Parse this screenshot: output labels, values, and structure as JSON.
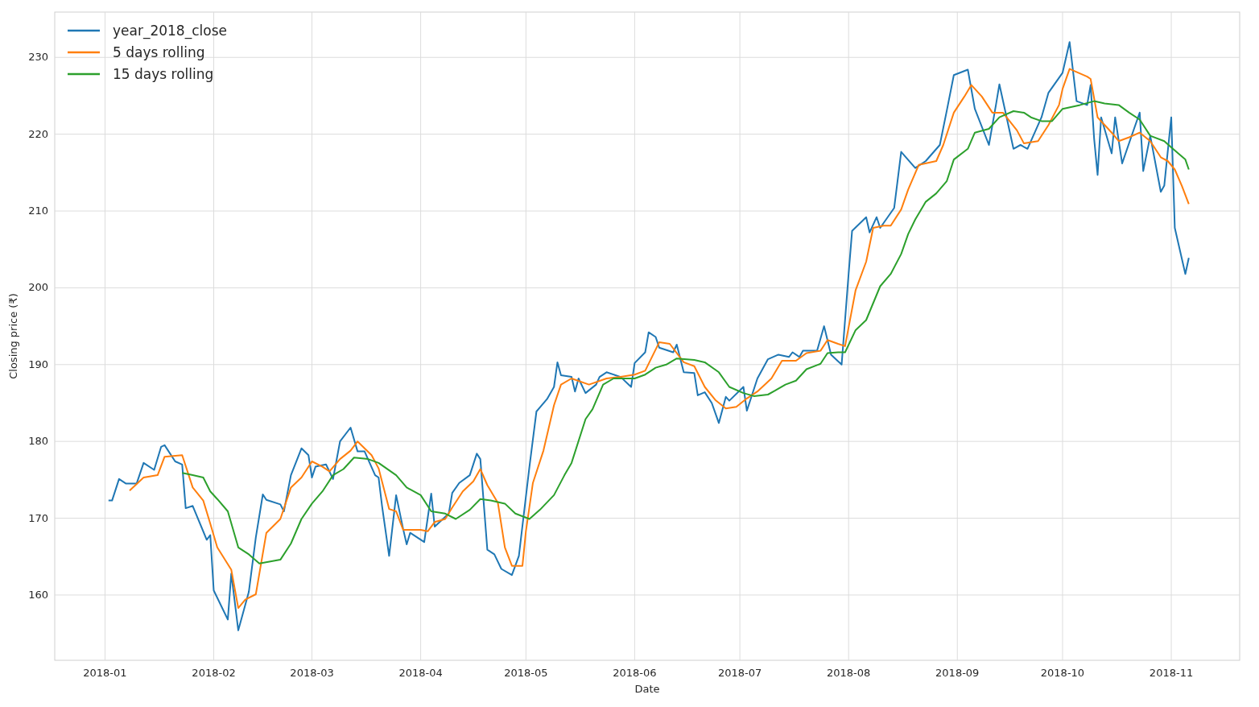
{
  "chart_data": {
    "type": "line",
    "grid": true,
    "legend": "upper left",
    "xlabel": "Date",
    "ylabel": "Closing price (₹)",
    "xlim": [
      "2017-12-17T16:00",
      "2018-11-20T12:00"
    ],
    "ylim": [
      151.5,
      235.9
    ],
    "xticks": [
      {
        "value": "2018-01-01",
        "label": "2018-01"
      },
      {
        "value": "2018-02-01",
        "label": "2018-02"
      },
      {
        "value": "2018-03-01",
        "label": "2018-03"
      },
      {
        "value": "2018-04-01",
        "label": "2018-04"
      },
      {
        "value": "2018-05-01",
        "label": "2018-05"
      },
      {
        "value": "2018-06-01",
        "label": "2018-06"
      },
      {
        "value": "2018-07-01",
        "label": "2018-07"
      },
      {
        "value": "2018-08-01",
        "label": "2018-08"
      },
      {
        "value": "2018-09-01",
        "label": "2018-09"
      },
      {
        "value": "2018-10-01",
        "label": "2018-10"
      },
      {
        "value": "2018-11-01",
        "label": "2018-11"
      }
    ],
    "yticks": [
      160,
      170,
      180,
      190,
      200,
      210,
      220,
      230
    ],
    "series": [
      {
        "name": "year_2018_close",
        "color": "#1f77b4",
        "x": [
          "2018-01-02",
          "2018-01-03",
          "2018-01-05",
          "2018-01-07",
          "2018-01-10",
          "2018-01-12",
          "2018-01-15",
          "2018-01-17",
          "2018-01-18",
          "2018-01-21",
          "2018-01-23",
          "2018-01-24",
          "2018-01-26",
          "2018-01-30",
          "2018-01-31",
          "2018-02-01",
          "2018-02-05",
          "2018-02-06",
          "2018-02-08",
          "2018-02-11",
          "2018-02-13",
          "2018-02-15",
          "2018-02-16",
          "2018-02-20",
          "2018-02-21",
          "2018-02-23",
          "2018-02-26",
          "2018-02-28",
          "2018-03-01",
          "2018-03-02",
          "2018-03-05",
          "2018-03-07",
          "2018-03-09",
          "2018-03-12",
          "2018-03-14",
          "2018-03-16",
          "2018-03-19",
          "2018-03-20",
          "2018-03-21",
          "2018-03-23",
          "2018-03-25",
          "2018-03-27",
          "2018-03-28",
          "2018-03-29",
          "2018-04-02",
          "2018-04-04",
          "2018-04-05",
          "2018-04-09",
          "2018-04-10",
          "2018-04-12",
          "2018-04-15",
          "2018-04-17",
          "2018-04-18",
          "2018-04-20",
          "2018-04-22",
          "2018-04-24",
          "2018-04-27",
          "2018-04-29",
          "2018-05-02",
          "2018-05-04",
          "2018-05-07",
          "2018-05-09",
          "2018-05-10",
          "2018-05-11",
          "2018-05-14",
          "2018-05-15",
          "2018-05-16",
          "2018-05-18",
          "2018-05-21",
          "2018-05-22",
          "2018-05-24",
          "2018-05-28",
          "2018-05-31",
          "2018-06-01",
          "2018-06-04",
          "2018-06-05",
          "2018-06-07",
          "2018-06-08",
          "2018-06-12",
          "2018-06-13",
          "2018-06-15",
          "2018-06-18",
          "2018-06-19",
          "2018-06-21",
          "2018-06-23",
          "2018-06-25",
          "2018-06-27",
          "2018-06-28",
          "2018-07-02",
          "2018-07-03",
          "2018-07-06",
          "2018-07-09",
          "2018-07-12",
          "2018-07-15",
          "2018-07-16",
          "2018-07-18",
          "2018-07-19",
          "2018-07-23",
          "2018-07-25",
          "2018-07-27",
          "2018-07-30",
          "2018-08-01",
          "2018-08-02",
          "2018-08-06",
          "2018-08-07",
          "2018-08-09",
          "2018-08-10",
          "2018-08-14",
          "2018-08-16",
          "2018-08-20",
          "2018-08-23",
          "2018-08-27",
          "2018-08-29",
          "2018-08-31",
          "2018-09-04",
          "2018-09-06",
          "2018-09-10",
          "2018-09-12",
          "2018-09-13",
          "2018-09-17",
          "2018-09-19",
          "2018-09-21",
          "2018-09-25",
          "2018-09-27",
          "2018-10-01",
          "2018-10-03",
          "2018-10-05",
          "2018-10-08",
          "2018-10-09",
          "2018-10-10",
          "2018-10-11",
          "2018-10-12",
          "2018-10-15",
          "2018-10-16",
          "2018-10-18",
          "2018-10-21",
          "2018-10-23",
          "2018-10-24",
          "2018-10-26",
          "2018-10-29",
          "2018-10-30",
          "2018-11-01",
          "2018-11-02",
          "2018-11-05",
          "2018-11-06"
        ],
        "values": [
          172.3,
          172.3,
          175.1,
          174.5,
          174.5,
          177.2,
          176.3,
          179.3,
          179.5,
          177.4,
          177,
          171.3,
          171.6,
          167.2,
          167.8,
          160.6,
          156.8,
          162.8,
          155.4,
          160.4,
          167.5,
          173.1,
          172.4,
          171.8,
          170.9,
          175.6,
          179.1,
          178.2,
          175.3,
          176.7,
          177,
          175.1,
          180,
          181.8,
          178.7,
          178.7,
          175.6,
          175.3,
          171.5,
          165.1,
          173,
          168.6,
          166.6,
          168.1,
          166.9,
          173.2,
          168.9,
          170.6,
          173.3,
          174.6,
          175.6,
          178.4,
          177.7,
          165.9,
          165.3,
          163.4,
          162.6,
          165.1,
          176.7,
          183.9,
          185.5,
          187.1,
          190.3,
          188.6,
          188.4,
          186.5,
          188.2,
          186.3,
          187.4,
          188.4,
          189,
          188.4,
          187.1,
          190.2,
          191.6,
          194.2,
          193.6,
          192.2,
          191.6,
          192.6,
          189,
          188.9,
          186,
          186.4,
          185,
          182.4,
          185.8,
          185.3,
          187.1,
          184,
          188.2,
          190.7,
          191.3,
          191,
          191.6,
          191,
          191.8,
          191.8,
          195,
          191.3,
          190,
          201.8,
          207.4,
          209.2,
          207.2,
          209.2,
          207.8,
          210.4,
          217.7,
          215.6,
          216.5,
          218.6,
          223.1,
          227.7,
          228.4,
          223.3,
          218.6,
          223.8,
          226.5,
          218.1,
          218.6,
          218.1,
          222.2,
          225.4,
          228,
          232,
          224.3,
          223.8,
          226.4,
          219.4,
          214.7,
          222.2,
          217.5,
          222.2,
          216.2,
          220.2,
          222.8,
          215.2,
          219.8,
          212.5,
          213.3,
          222.2,
          207.8,
          201.8,
          203.9
        ]
      },
      {
        "name": "5 days rolling",
        "color": "#ff7f0e",
        "x": [
          "2018-01-08",
          "2018-01-12",
          "2018-01-16",
          "2018-01-18",
          "2018-01-23",
          "2018-01-26",
          "2018-01-29",
          "2018-01-31",
          "2018-02-02",
          "2018-02-06",
          "2018-02-08",
          "2018-02-10",
          "2018-02-13",
          "2018-02-16",
          "2018-02-20",
          "2018-02-23",
          "2018-02-26",
          "2018-03-01",
          "2018-03-04",
          "2018-03-06",
          "2018-03-09",
          "2018-03-12",
          "2018-03-14",
          "2018-03-18",
          "2018-03-20",
          "2018-03-23",
          "2018-03-25",
          "2018-03-27",
          "2018-04-01",
          "2018-04-03",
          "2018-04-05",
          "2018-04-08",
          "2018-04-10",
          "2018-04-13",
          "2018-04-16",
          "2018-04-18",
          "2018-04-20",
          "2018-04-23",
          "2018-04-25",
          "2018-04-27",
          "2018-04-30",
          "2018-05-01",
          "2018-05-03",
          "2018-05-06",
          "2018-05-09",
          "2018-05-11",
          "2018-05-14",
          "2018-05-19",
          "2018-05-24",
          "2018-05-28",
          "2018-06-01",
          "2018-06-04",
          "2018-06-08",
          "2018-06-11",
          "2018-06-15",
          "2018-06-18",
          "2018-06-21",
          "2018-06-24",
          "2018-06-27",
          "2018-06-30",
          "2018-07-03",
          "2018-07-06",
          "2018-07-10",
          "2018-07-13",
          "2018-07-17",
          "2018-07-20",
          "2018-07-24",
          "2018-07-26",
          "2018-07-29",
          "2018-07-31",
          "2018-08-03",
          "2018-08-06",
          "2018-08-08",
          "2018-08-11",
          "2018-08-13",
          "2018-08-16",
          "2018-08-18",
          "2018-08-21",
          "2018-08-26",
          "2018-08-28",
          "2018-08-31",
          "2018-09-03",
          "2018-09-05",
          "2018-09-08",
          "2018-09-11",
          "2018-09-14",
          "2018-09-18",
          "2018-09-20",
          "2018-09-24",
          "2018-09-27",
          "2018-09-30",
          "2018-10-01",
          "2018-10-03",
          "2018-10-08",
          "2018-10-09",
          "2018-10-11",
          "2018-10-15",
          "2018-10-17",
          "2018-10-20",
          "2018-10-23",
          "2018-10-26",
          "2018-10-29",
          "2018-10-31",
          "2018-11-02",
          "2018-11-04",
          "2018-11-06"
        ],
        "values": [
          173.6,
          175.3,
          175.6,
          178,
          178.2,
          174,
          172.3,
          169.3,
          166.2,
          163.3,
          158.3,
          159.4,
          160.1,
          168.1,
          169.9,
          174,
          175.3,
          177.4,
          176.7,
          176.1,
          177.7,
          178.8,
          180,
          178.2,
          176.5,
          171.2,
          170.9,
          168.5,
          168.5,
          168.3,
          169.5,
          169.9,
          171.4,
          173.5,
          174.8,
          176.4,
          174.3,
          172,
          166.2,
          163.8,
          163.8,
          168.3,
          174.6,
          178.8,
          184.7,
          187.4,
          188.2,
          187.4,
          188.2,
          188.4,
          188.7,
          189.2,
          192.9,
          192.7,
          190.3,
          189.8,
          187.1,
          185.4,
          184.3,
          184.5,
          185.6,
          186.5,
          188.2,
          190.5,
          190.5,
          191.5,
          191.8,
          193.2,
          192.7,
          192.4,
          199.7,
          203.4,
          207.8,
          208.1,
          208.1,
          210.2,
          212.8,
          216,
          216.5,
          218.6,
          222.8,
          224.9,
          226.4,
          224.9,
          222.8,
          222.8,
          220.5,
          218.8,
          219.1,
          221.2,
          223.8,
          225.9,
          228.5,
          227.5,
          227.2,
          222.2,
          220.2,
          219.1,
          219.6,
          220.2,
          219.1,
          217,
          216.5,
          215.4,
          213.3,
          210.9
        ]
      },
      {
        "name": "15 days rolling",
        "color": "#2ca02c",
        "x": [
          "2018-01-23",
          "2018-01-26",
          "2018-01-29",
          "2018-01-31",
          "2018-02-02",
          "2018-02-05",
          "2018-02-08",
          "2018-02-11",
          "2018-02-14",
          "2018-02-20",
          "2018-02-23",
          "2018-02-26",
          "2018-03-01",
          "2018-03-04",
          "2018-03-07",
          "2018-03-10",
          "2018-03-13",
          "2018-03-17",
          "2018-03-20",
          "2018-03-25",
          "2018-03-28",
          "2018-04-01",
          "2018-04-04",
          "2018-04-08",
          "2018-04-11",
          "2018-04-15",
          "2018-04-18",
          "2018-04-21",
          "2018-04-25",
          "2018-04-28",
          "2018-05-02",
          "2018-05-05",
          "2018-05-09",
          "2018-05-12",
          "2018-05-14",
          "2018-05-18",
          "2018-05-20",
          "2018-05-23",
          "2018-05-26",
          "2018-06-01",
          "2018-06-04",
          "2018-06-07",
          "2018-06-10",
          "2018-06-13",
          "2018-06-18",
          "2018-06-21",
          "2018-06-25",
          "2018-06-28",
          "2018-07-02",
          "2018-07-05",
          "2018-07-09",
          "2018-07-11",
          "2018-07-14",
          "2018-07-17",
          "2018-07-20",
          "2018-07-24",
          "2018-07-26",
          "2018-07-29",
          "2018-07-31",
          "2018-08-03",
          "2018-08-06",
          "2018-08-10",
          "2018-08-13",
          "2018-08-16",
          "2018-08-18",
          "2018-08-20",
          "2018-08-23",
          "2018-08-26",
          "2018-08-29",
          "2018-08-31",
          "2018-09-04",
          "2018-09-06",
          "2018-09-10",
          "2018-09-13",
          "2018-09-17",
          "2018-09-20",
          "2018-09-22",
          "2018-09-25",
          "2018-09-28",
          "2018-10-01",
          "2018-10-06",
          "2018-10-10",
          "2018-10-13",
          "2018-10-17",
          "2018-10-20",
          "2018-10-23",
          "2018-10-26",
          "2018-10-30",
          "2018-11-01",
          "2018-11-03",
          "2018-11-05",
          "2018-11-06"
        ],
        "values": [
          175.9,
          175.6,
          175.3,
          173.5,
          172.5,
          170.9,
          166.2,
          165.3,
          164.1,
          164.6,
          166.7,
          169.9,
          171.9,
          173.5,
          175.6,
          176.4,
          177.9,
          177.7,
          177.2,
          175.6,
          174,
          173,
          170.9,
          170.6,
          169.9,
          171.1,
          172.5,
          172.3,
          171.9,
          170.6,
          169.9,
          171.1,
          173,
          175.6,
          177.2,
          182.9,
          184.2,
          187.4,
          188.2,
          188.2,
          188.7,
          189.6,
          190,
          190.8,
          190.6,
          190.3,
          189,
          187.1,
          186.3,
          185.9,
          186.1,
          186.6,
          187.4,
          187.9,
          189.4,
          190.1,
          191.5,
          191.6,
          191.6,
          194.5,
          195.8,
          200.2,
          201.8,
          204.4,
          207,
          208.9,
          211.2,
          212.3,
          213.9,
          216.7,
          218.1,
          220.2,
          220.7,
          222.2,
          223,
          222.8,
          222.2,
          221.7,
          221.7,
          223.3,
          223.8,
          224.3,
          224,
          223.8,
          222.8,
          221.9,
          219.8,
          219.1,
          218.3,
          217.5,
          216.7,
          215.4
        ]
      }
    ]
  }
}
